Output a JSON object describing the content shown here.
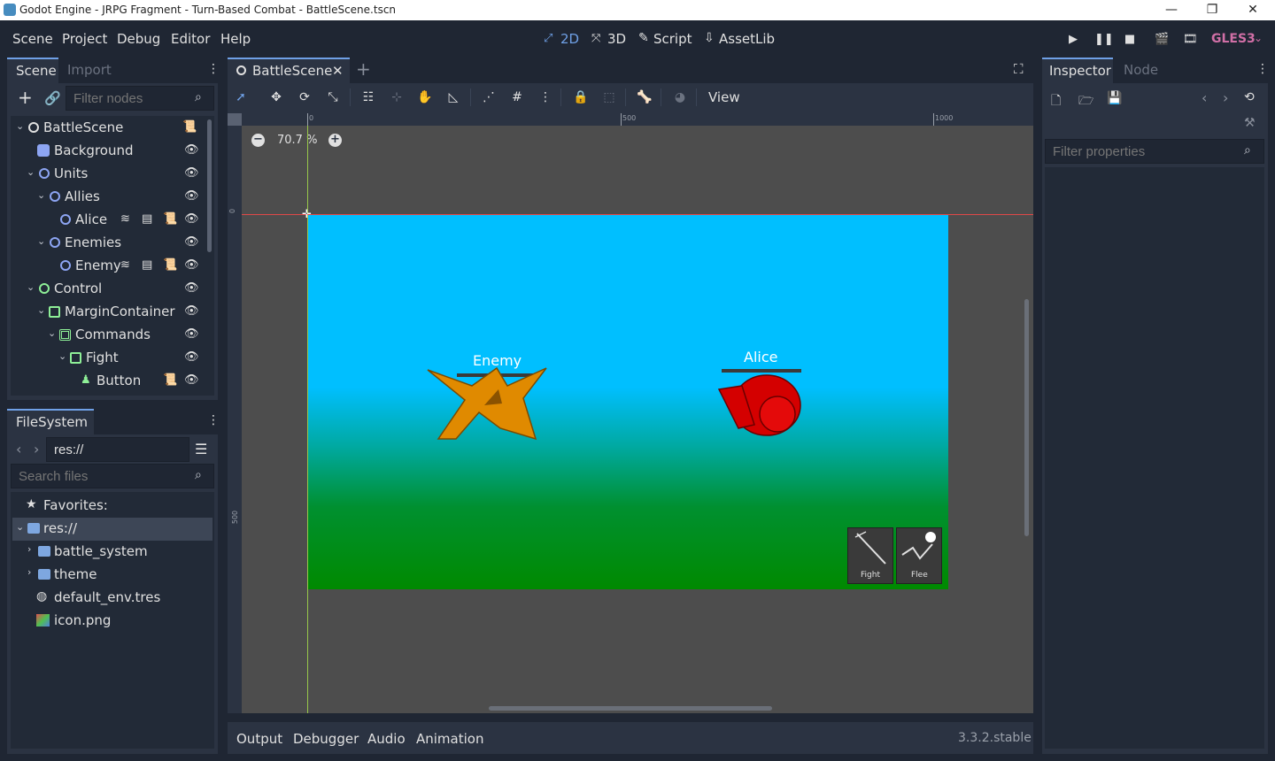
{
  "window": {
    "title": "Godot Engine - JRPG Fragment - Turn-Based Combat - BattleScene.tscn",
    "min": "—",
    "max": "❐",
    "close": "✕"
  },
  "menu": [
    "Scene",
    "Project",
    "Debug",
    "Editor",
    "Help"
  ],
  "workspaces": [
    {
      "label": "2D",
      "icon": "2d-icon",
      "active": true
    },
    {
      "label": "3D",
      "icon": "3d-icon"
    },
    {
      "label": "Script",
      "icon": "script-icon"
    },
    {
      "label": "AssetLib",
      "icon": "assetlib-icon"
    }
  ],
  "renderer": "GLES3",
  "scene_dock": {
    "tabs": [
      "Scene",
      "Import"
    ],
    "filter_placeholder": "Filter nodes",
    "nodes": [
      {
        "label": "BattleScene",
        "depth": 0
      },
      {
        "label": "Background",
        "depth": 1
      },
      {
        "label": "Units",
        "depth": 1
      },
      {
        "label": "Allies",
        "depth": 2
      },
      {
        "label": "Alice",
        "depth": 3
      },
      {
        "label": "Enemies",
        "depth": 2
      },
      {
        "label": "Enemy",
        "depth": 3
      },
      {
        "label": "Control",
        "depth": 1
      },
      {
        "label": "MarginContainer",
        "depth": 2
      },
      {
        "label": "Commands",
        "depth": 3
      },
      {
        "label": "Fight",
        "depth": 4
      },
      {
        "label": "Button",
        "depth": 5
      }
    ]
  },
  "filesystem": {
    "tab": "FileSystem",
    "path": "res://",
    "search_placeholder": "Search files",
    "favorites": "Favorites:",
    "items": [
      "res://",
      "battle_system",
      "theme",
      "default_env.tres",
      "icon.png"
    ]
  },
  "editor": {
    "tab": "BattleScene",
    "view_menu": "View",
    "zoom": "70.7 %",
    "ruler_marks": [
      "0",
      "500",
      "1000"
    ],
    "ruler_v_marks": [
      "0",
      "500"
    ],
    "enemy_label": "Enemy",
    "alice_label": "Alice",
    "fight_label": "Fight",
    "flee_label": "Flee"
  },
  "bottom_panel": {
    "tabs": [
      "Output",
      "Debugger",
      "Audio",
      "Animation"
    ],
    "version": "3.3.2.stable"
  },
  "inspector": {
    "tabs": [
      "Inspector",
      "Node"
    ],
    "filter_placeholder": "Filter properties"
  },
  "colors": {
    "accent": "#6fa0e6",
    "sky": "#00bfff",
    "grass": "#008a00",
    "enemy": "#e08a00",
    "alice": "#d40000"
  }
}
